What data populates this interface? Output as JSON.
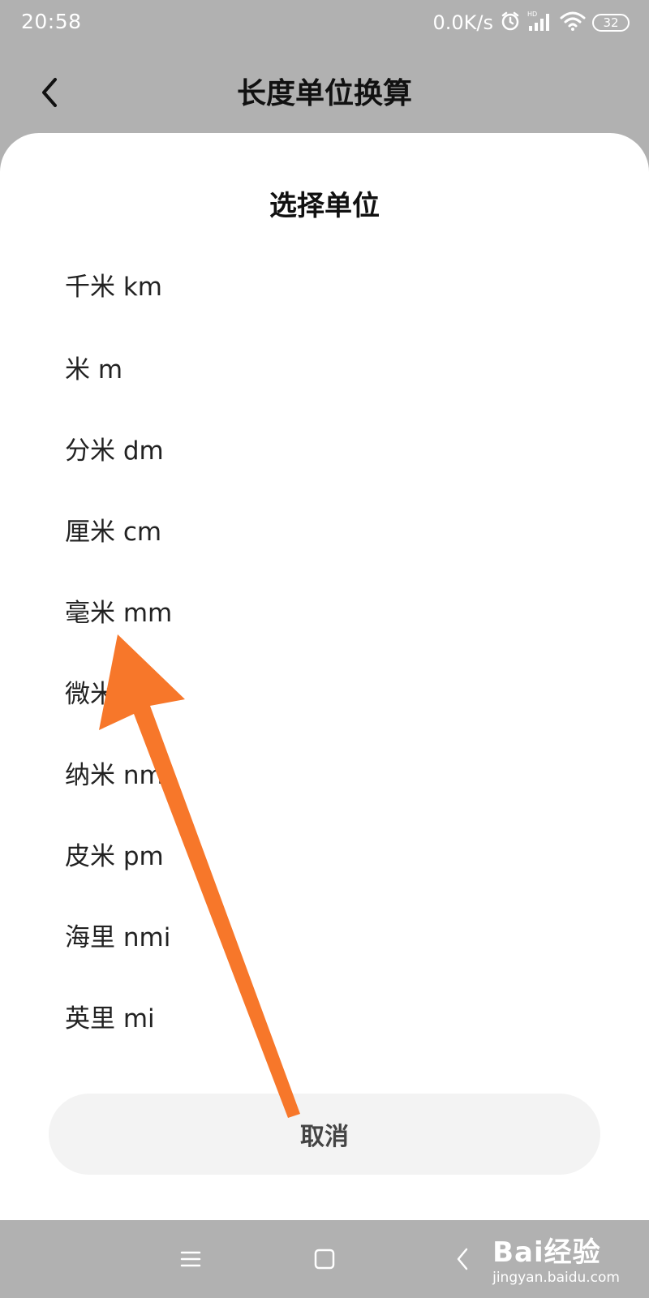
{
  "status_bar": {
    "time": "20:58",
    "net_speed": "0.0K/s",
    "battery": "32",
    "icons": [
      "alarm-icon",
      "hd-signal-icon",
      "wifi-icon",
      "battery-icon"
    ]
  },
  "header": {
    "title": "长度单位换算",
    "back_icon": "chevron-left-icon"
  },
  "sheet": {
    "title": "选择单位",
    "units": [
      {
        "label": "千米 km"
      },
      {
        "label": "米 m"
      },
      {
        "label": "分米 dm"
      },
      {
        "label": "厘米 cm"
      },
      {
        "label": "毫米 mm"
      },
      {
        "label": "微米 μm"
      },
      {
        "label": "纳米 nm"
      },
      {
        "label": "皮米 pm"
      },
      {
        "label": "海里 nmi"
      },
      {
        "label": "英里 mi"
      }
    ],
    "cancel_label": "取消"
  },
  "nav_bar": {
    "icons": [
      "menu-icon",
      "home-square-icon",
      "back-chevron-icon"
    ]
  },
  "watermark": {
    "logo": "Bai经验",
    "url": "jingyan.baidu.com"
  },
  "colors": {
    "dim_overlay": "#b1b1b1",
    "sheet_bg": "#ffffff",
    "cancel_bg": "#f3f3f3",
    "arrow": "#f7772a"
  }
}
